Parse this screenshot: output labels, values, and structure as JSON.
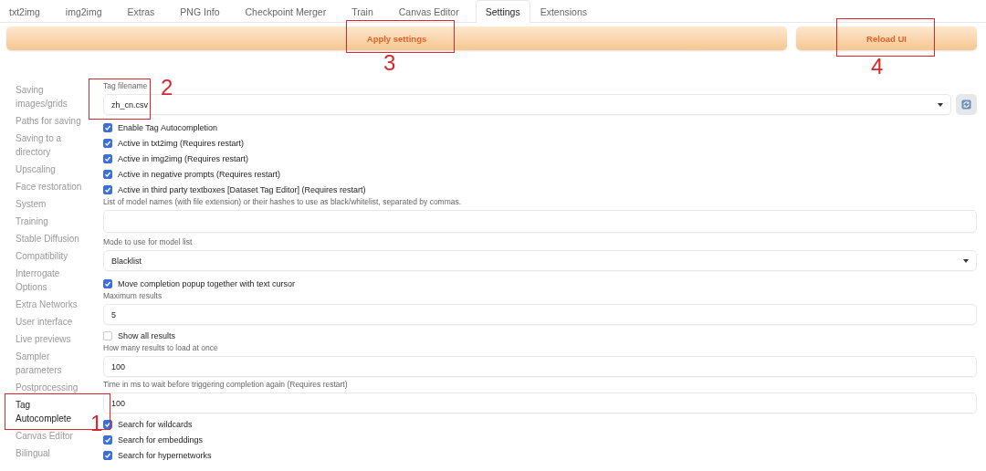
{
  "tabs": [
    {
      "label": "txt2img",
      "selected": false
    },
    {
      "label": "img2img",
      "selected": false
    },
    {
      "label": "Extras",
      "selected": false
    },
    {
      "label": "PNG Info",
      "selected": false
    },
    {
      "label": "Checkpoint Merger",
      "selected": false
    },
    {
      "label": "Train",
      "selected": false
    },
    {
      "label": "Canvas Editor",
      "selected": false
    },
    {
      "label": "Settings",
      "selected": true
    },
    {
      "label": "Extensions",
      "selected": false
    }
  ],
  "actions": {
    "apply": "Apply settings",
    "reload": "Reload UI"
  },
  "sidebar": {
    "items": [
      {
        "label": "Saving images/grids",
        "selected": false
      },
      {
        "label": "Paths for saving",
        "selected": false
      },
      {
        "label": "Saving to a directory",
        "selected": false
      },
      {
        "label": "Upscaling",
        "selected": false
      },
      {
        "label": "Face restoration",
        "selected": false
      },
      {
        "label": "System",
        "selected": false
      },
      {
        "label": "Training",
        "selected": false
      },
      {
        "label": "Stable Diffusion",
        "selected": false
      },
      {
        "label": "Compatibility",
        "selected": false
      },
      {
        "label": "Interrogate Options",
        "selected": false
      },
      {
        "label": "Extra Networks",
        "selected": false
      },
      {
        "label": "User interface",
        "selected": false
      },
      {
        "label": "Live previews",
        "selected": false
      },
      {
        "label": "Sampler parameters",
        "selected": false
      },
      {
        "label": "Postprocessing",
        "selected": false
      },
      {
        "label": "Tag Autocomplete",
        "selected": true
      },
      {
        "label": "Canvas Editor",
        "selected": false
      },
      {
        "label": "Bilingual",
        "selected": false
      }
    ]
  },
  "settings": [
    {
      "kind": "dropdown",
      "label": "Tag filename",
      "value": "zh_cn.csv",
      "refresh": true
    },
    {
      "kind": "checkbox",
      "label": "Enable Tag Autocompletion",
      "checked": true
    },
    {
      "kind": "checkbox",
      "label": "Active in txt2img (Requires restart)",
      "checked": true
    },
    {
      "kind": "checkbox",
      "label": "Active in img2img (Requires restart)",
      "checked": true
    },
    {
      "kind": "checkbox",
      "label": "Active in negative prompts (Requires restart)",
      "checked": true
    },
    {
      "kind": "checkbox",
      "label": "Active in third party textboxes [Dataset Tag Editor] (Requires restart)",
      "checked": true
    },
    {
      "kind": "textarea",
      "label": "List of model names (with file extension) or their hashes to use as black/whitelist, separated by commas."
    },
    {
      "kind": "dropdown",
      "label": "Mode to use for model list",
      "value": "Blacklist",
      "refresh": false
    },
    {
      "kind": "checkbox",
      "label": "Move completion popup together with text cursor",
      "checked": true
    },
    {
      "kind": "number",
      "label": "Maximum results",
      "value": "5"
    },
    {
      "kind": "checkbox",
      "label": "Show all results",
      "checked": false
    },
    {
      "kind": "number",
      "label": "How many results to load at once",
      "value": "100"
    },
    {
      "kind": "number",
      "label": "Time in ms to wait before triggering completion again (Requires restart)",
      "value": "100"
    },
    {
      "kind": "checkbox",
      "label": "Search for wildcards",
      "checked": true
    },
    {
      "kind": "checkbox",
      "label": "Search for embeddings",
      "checked": true
    },
    {
      "kind": "checkbox",
      "label": "Search for hypernetworks",
      "checked": true
    }
  ],
  "annotations": [
    "1",
    "2",
    "3",
    "4"
  ]
}
